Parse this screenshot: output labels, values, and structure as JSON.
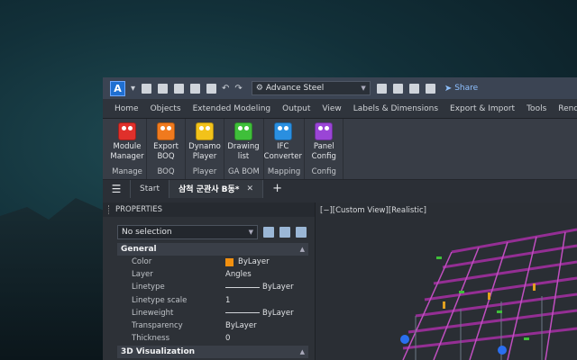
{
  "qat": {
    "logo": "A",
    "workspace": "Advance Steel",
    "share": "Share"
  },
  "ribbon_tabs": [
    "Home",
    "Objects",
    "Extended Modeling",
    "Output",
    "View",
    "Labels & Dimensions",
    "Export & Import",
    "Tools",
    "Render"
  ],
  "ribbon_groups": [
    {
      "title": "Manage",
      "buttons": [
        {
          "label": "Module\nManager",
          "color": "#e0302b"
        }
      ]
    },
    {
      "title": "BOQ",
      "buttons": [
        {
          "label": "Export\nBOQ",
          "color": "#f07a1e"
        }
      ]
    },
    {
      "title": "Player",
      "buttons": [
        {
          "label": "Dynamo\nPlayer",
          "color": "#f2c21a"
        }
      ]
    },
    {
      "title": "GA BOM",
      "buttons": [
        {
          "label": "Drawing\nlist",
          "color": "#3fbf3a"
        }
      ]
    },
    {
      "title": "Mapping",
      "buttons": [
        {
          "label": "IFC\nConverter",
          "color": "#2a8fe0"
        }
      ]
    },
    {
      "title": "Config",
      "buttons": [
        {
          "label": "Panel\nConfig",
          "color": "#9a45d6"
        }
      ]
    }
  ],
  "doc_tabs": {
    "start": "Start",
    "active": "삼척 군관사 B동*",
    "close": "✕",
    "add": "+"
  },
  "properties": {
    "title": "PROPERTIES",
    "selection": "No selection",
    "general_header": "General",
    "rows": [
      {
        "name": "Color",
        "value": "ByLayer",
        "kind": "swatch"
      },
      {
        "name": "Layer",
        "value": "Angles",
        "kind": "text"
      },
      {
        "name": "Linetype",
        "value": "ByLayer",
        "kind": "line"
      },
      {
        "name": "Linetype scale",
        "value": "1",
        "kind": "text"
      },
      {
        "name": "Lineweight",
        "value": "ByLayer",
        "kind": "line"
      },
      {
        "name": "Transparency",
        "value": "ByLayer",
        "kind": "text"
      },
      {
        "name": "Thickness",
        "value": "0",
        "kind": "text"
      }
    ],
    "viz_header": "3D Visualization"
  },
  "viewport": {
    "label": "[−][Custom View][Realistic]"
  }
}
